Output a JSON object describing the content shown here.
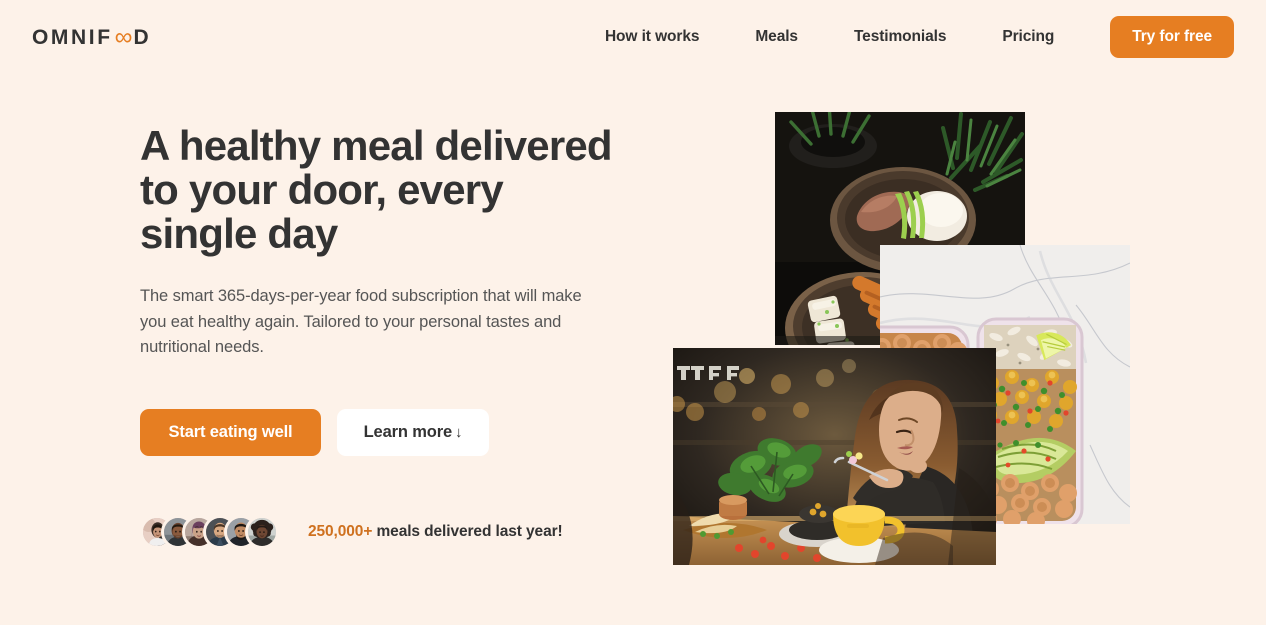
{
  "header": {
    "logo": {
      "prefix": "OMNIF",
      "infinity": "∞",
      "suffix": "D",
      "name": "OMNIFOOD"
    },
    "nav": [
      {
        "label": "How it works"
      },
      {
        "label": "Meals"
      },
      {
        "label": "Testimonials"
      },
      {
        "label": "Pricing"
      }
    ],
    "cta_label": "Try for free"
  },
  "hero": {
    "headline": "A healthy meal delivered to your door, every single day",
    "description": "The smart 365-days-per-year food subscription that will make you eat healthy again. Tailored to your personal tastes and nutritional needs.",
    "primary_button": "Start eating well",
    "secondary_button": "Learn more",
    "secondary_button_arrow": "↓",
    "delivered": {
      "count": "250,000+",
      "text": "meals delivered last year!",
      "avatar_count": 6,
      "avatars": [
        {
          "name": "customer-1"
        },
        {
          "name": "customer-2"
        },
        {
          "name": "customer-3"
        },
        {
          "name": "customer-4"
        },
        {
          "name": "customer-5"
        },
        {
          "name": "customer-6"
        }
      ]
    },
    "images": [
      {
        "name": "bowls-on-dark-table",
        "alt": "Two healthy meal bowls with rice, salmon and grilled vegetables on a dark table with plants"
      },
      {
        "name": "meal-prep-containers",
        "alt": "Two meal prep containers with chickpeas, avocado, rice and lime on white marble"
      },
      {
        "name": "woman-eating-in-cafe",
        "alt": "Woman enjoying a healthy meal with a yellow mug in a warmly lit cafe"
      }
    ]
  },
  "colors": {
    "background": "#fdf2e9",
    "accent": "#e67e22",
    "accent_dark": "#cf711f",
    "text": "#333333",
    "text_muted": "#555555",
    "button_text": "#ffffff"
  }
}
